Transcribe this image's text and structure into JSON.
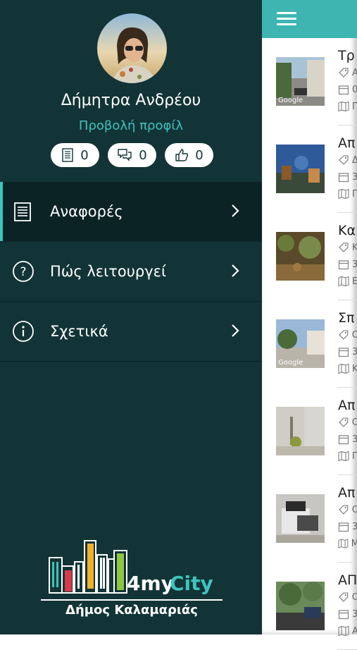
{
  "drawer": {
    "user_name": "Δήμητρα Ανδρέου",
    "profile_link": "Προβολή προφίλ",
    "stats": {
      "reports": "0",
      "comments": "0",
      "likes": "0"
    },
    "menu": [
      {
        "label": "Αναφορές",
        "icon": "reports-icon",
        "active": true
      },
      {
        "label": "Πώς λειτουργεί",
        "icon": "question-icon",
        "active": false
      },
      {
        "label": "Σχετικά",
        "icon": "info-icon",
        "active": false
      }
    ],
    "brand": {
      "logo_text": "4myCity",
      "subtitle": "Δήμος Καλαμαριάς"
    }
  },
  "colors": {
    "drawer_bg": "#123436",
    "accent": "#3fc3bf",
    "topbar": "#3fb5b1"
  },
  "list": [
    {
      "title": "Τρ",
      "tag": "Α",
      "date": "0",
      "place": "Γ",
      "thumb_label": "Google"
    },
    {
      "title": "Απ",
      "tag": "Δ",
      "date": "3",
      "place": "Π",
      "thumb_label": ""
    },
    {
      "title": "Κα",
      "tag": "Κ",
      "date": "3",
      "place": "Ε",
      "thumb_label": ""
    },
    {
      "title": "Σπ",
      "tag": "Ο",
      "date": "3",
      "place": "Κ",
      "thumb_label": "Google"
    },
    {
      "title": "Απ",
      "tag": "Ο",
      "date": "3",
      "place": "Π",
      "thumb_label": ""
    },
    {
      "title": "Απ",
      "tag": "Ο",
      "date": "3",
      "place": "Μ",
      "thumb_label": ""
    },
    {
      "title": "ΑΠ",
      "tag": "Ο",
      "date": "3",
      "place": "Α",
      "thumb_label": ""
    }
  ]
}
